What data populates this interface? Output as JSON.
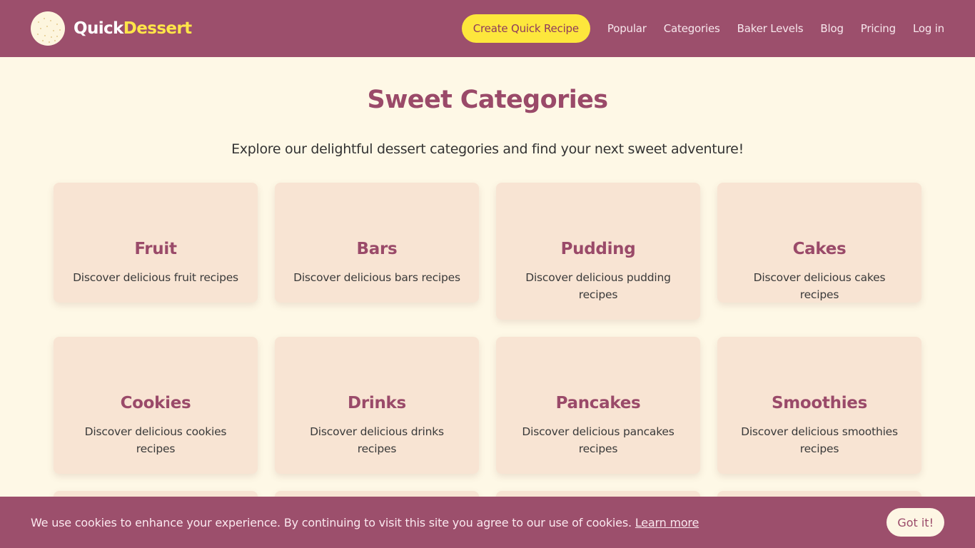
{
  "header": {
    "logo_part1": "Quick",
    "logo_part2": "Dessert",
    "cta_label": "Create Quick Recipe",
    "nav": [
      "Popular",
      "Categories",
      "Baker Levels",
      "Blog",
      "Pricing",
      "Log in"
    ]
  },
  "main": {
    "title": "Sweet Categories",
    "subtitle": "Explore our delightful dessert categories and find your next sweet adventure!",
    "categories": [
      {
        "name": "Fruit",
        "description": "Discover delicious fruit recipes"
      },
      {
        "name": "Bars",
        "description": "Discover delicious bars recipes"
      },
      {
        "name": "Pudding",
        "description": "Discover delicious pudding recipes"
      },
      {
        "name": "Cakes",
        "description": "Discover delicious cakes recipes"
      },
      {
        "name": "Cookies",
        "description": "Discover delicious cookies recipes"
      },
      {
        "name": "Drinks",
        "description": "Discover delicious drinks recipes"
      },
      {
        "name": "Pancakes",
        "description": "Discover delicious pancakes recipes"
      },
      {
        "name": "Smoothies",
        "description": "Discover delicious smoothies recipes"
      }
    ]
  },
  "cookie_banner": {
    "text": "We use cookies to enhance your experience. By continuing to visit this site you agree to our use of cookies.",
    "link_label": "Learn more",
    "button_label": "Got it!"
  },
  "colors": {
    "brand": "#9c4f6c",
    "accent": "#fde73c",
    "background": "#fef8e6",
    "card": "#f8e4d3"
  }
}
